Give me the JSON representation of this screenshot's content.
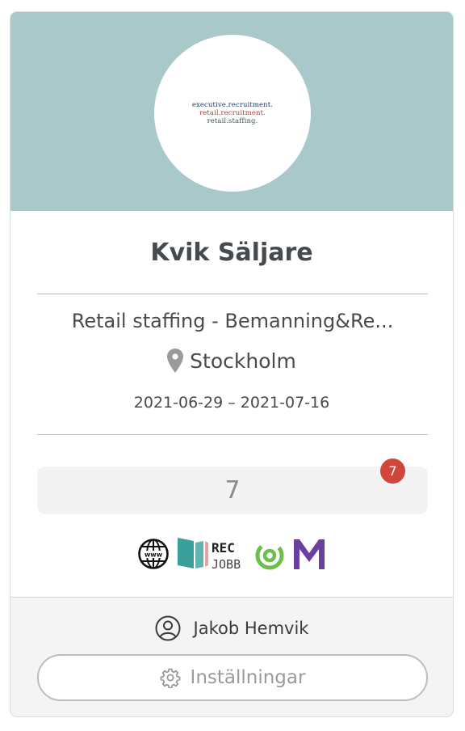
{
  "logo": {
    "line1": "executive.recruitment.",
    "line2": "retail.recruitment.",
    "line3": "retail.staffing.",
    "colors": {
      "line1": "#1f3a78",
      "line2": "#c0392b",
      "line3": "#2f5e3f"
    }
  },
  "ad": {
    "title": "Kvik Säljare",
    "subtitle": "Retail staffing - Bemanning&Re...",
    "location": "Stockholm",
    "dates": "2021-06-29 – 2021-07-16"
  },
  "applicants": {
    "count": "7",
    "new_badge": "7"
  },
  "platforms": {
    "icons": [
      "globe-www-icon",
      "rec-jobb-icon",
      "circular-logo-icon",
      "m-logo-icon"
    ],
    "rec_top": "REC",
    "rec_bottom": "JOBB",
    "www": "www"
  },
  "footer": {
    "owner": "Jakob Hemvik",
    "settings_label": "Inställningar"
  },
  "colors": {
    "banner": "#a8c8c9",
    "divider": "#9fc2c4",
    "badge": "#d1453c",
    "rec_teal": "#3a9e9b",
    "green_logo": "#6cc04a",
    "m_logo": "#6b3fa0"
  }
}
